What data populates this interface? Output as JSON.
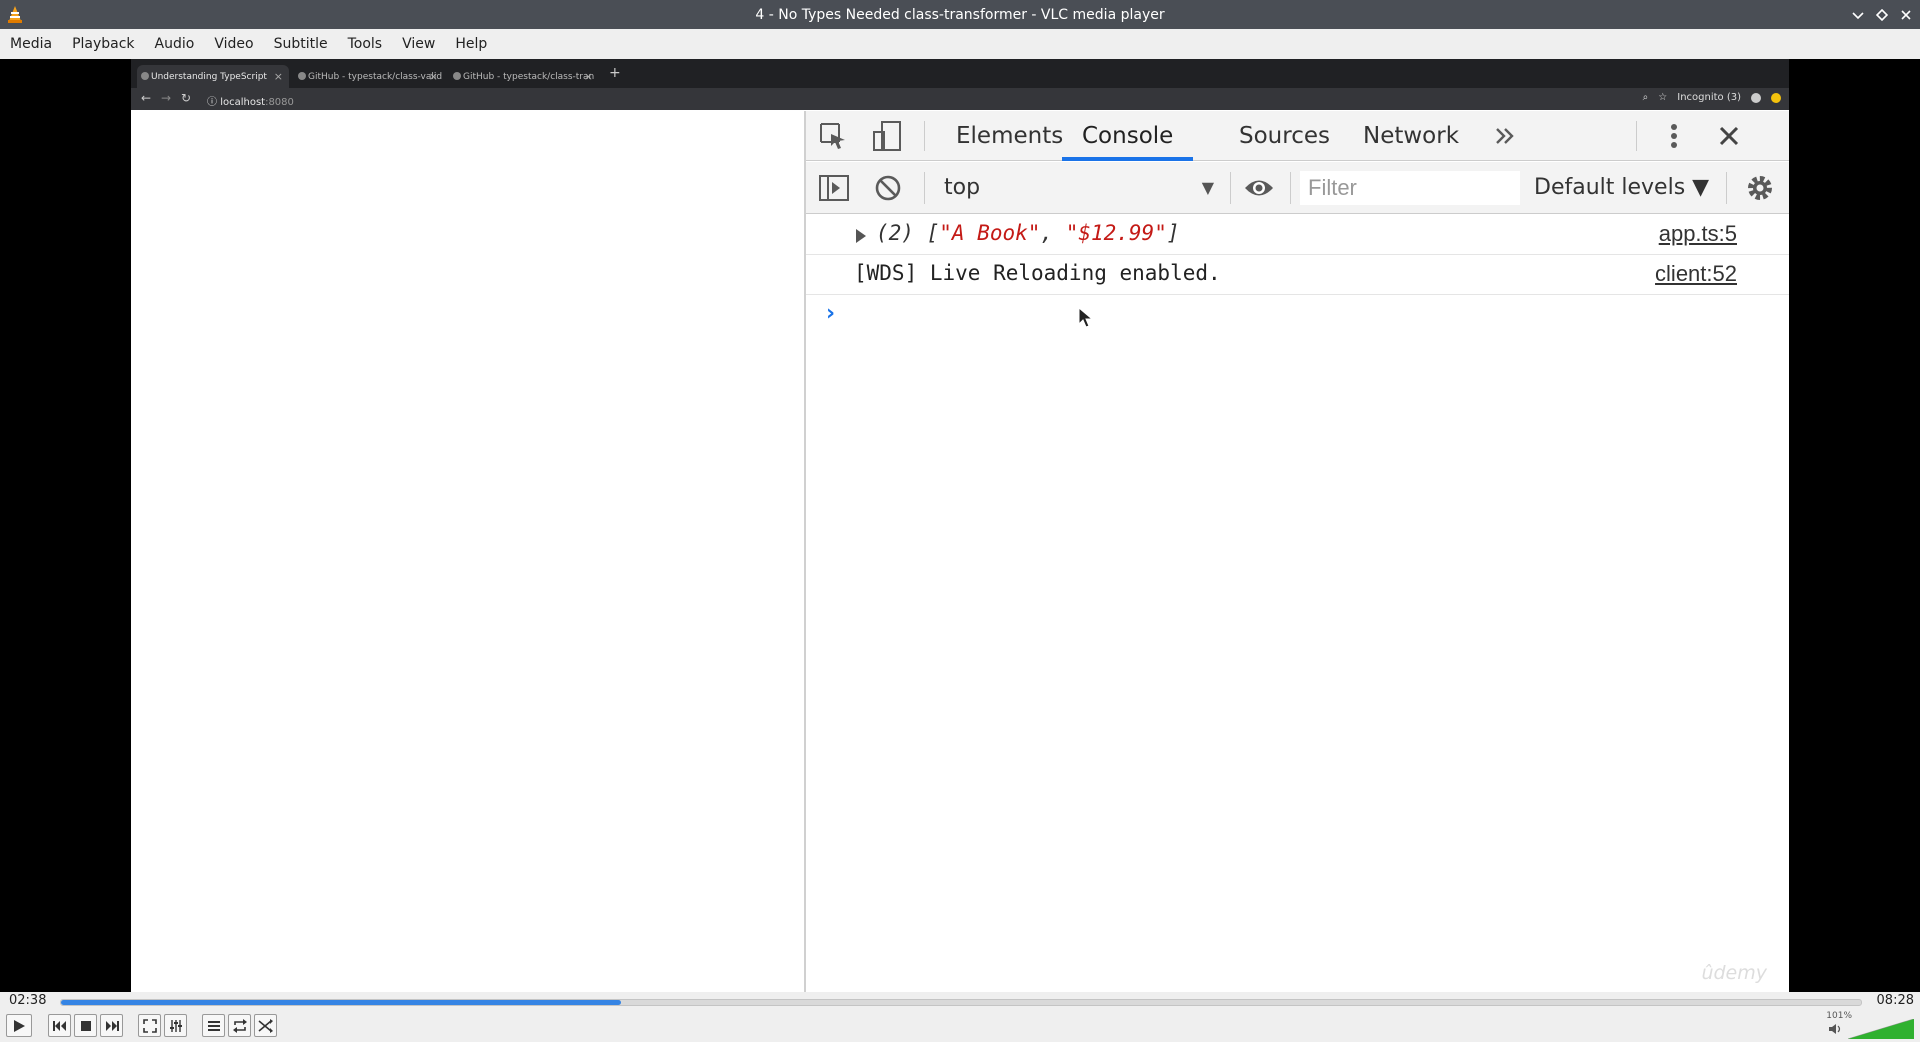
{
  "window": {
    "title": "4 - No Types Needed class-transformer - VLC media player"
  },
  "menu": [
    "Media",
    "Playback",
    "Audio",
    "Video",
    "Subtitle",
    "Tools",
    "View",
    "Help"
  ],
  "browser": {
    "tabs": [
      {
        "label": "Understanding TypeScript",
        "active": true
      },
      {
        "label": "GitHub - typestack/class-valid",
        "active": false
      },
      {
        "label": "GitHub - typestack/class-tran",
        "active": false
      }
    ],
    "url_host": "localhost",
    "url_port": ":8080",
    "incognito_label": "Incognito (3)"
  },
  "devtools": {
    "tabs": [
      "Elements",
      "Console",
      "Sources",
      "Network"
    ],
    "active_tab": "Console",
    "context": "top",
    "filter_placeholder": "Filter",
    "levels": "Default levels ▼",
    "logs": [
      {
        "count": "(2)",
        "open": "[",
        "item1": "\"A Book\"",
        "sep": ", ",
        "item2": "\"$12.99\"",
        "close": "]",
        "source": "app.ts:5"
      },
      {
        "message": "[WDS] Live Reloading enabled.",
        "source": "client:52"
      }
    ],
    "prompt": "›"
  },
  "watermark": "ûdemy",
  "player": {
    "current_time": "02:38",
    "total_time": "08:28",
    "progress_fraction": 0.311,
    "volume_label": "101%",
    "volume_fraction": 1.0,
    "accent": "#3584e4"
  }
}
